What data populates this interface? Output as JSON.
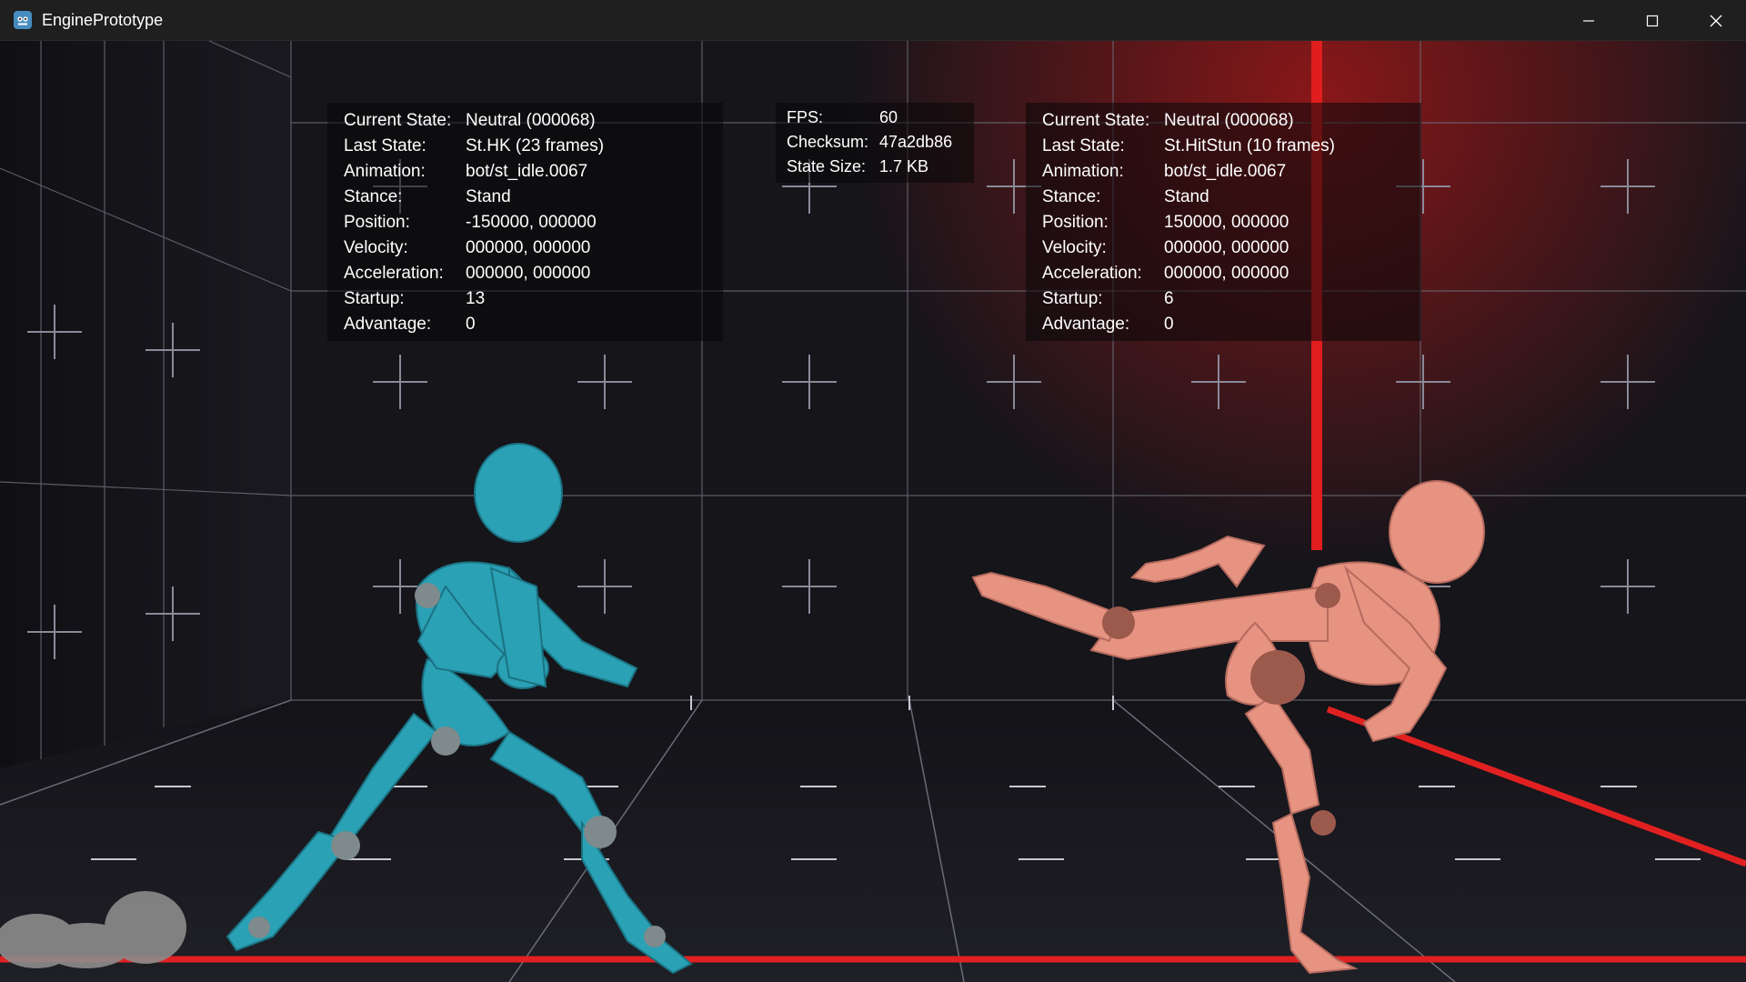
{
  "window": {
    "title": "EnginePrototype",
    "controls": {
      "minimize": "minimize-icon",
      "maximize": "maximize-icon",
      "close": "close-icon"
    }
  },
  "colors": {
    "titlebar": "#1f1f1f",
    "player1": "#2aa1b4",
    "player2": "#e79382",
    "boundary": "#e12121",
    "grid": "#7a7a8a"
  },
  "net_stats": {
    "fps_label": "FPS:",
    "fps_value": "60",
    "checksum_label": "Checksum:",
    "checksum_value": "47a2db86",
    "state_size_label": "State Size:",
    "state_size_value": "1.7 KB"
  },
  "player1": {
    "current_state_label": "Current State:",
    "current_state": "Neutral (000068)",
    "last_state_label": "Last State:",
    "last_state": "St.HK (23 frames)",
    "animation_label": "Animation:",
    "animation": "bot/st_idle.0067",
    "stance_label": "Stance:",
    "stance": "Stand",
    "position_label": "Position:",
    "position": "-150000, 000000",
    "velocity_label": "Velocity:",
    "velocity": "000000, 000000",
    "acceleration_label": "Acceleration:",
    "acceleration": "000000, 000000",
    "startup_label": "Startup:",
    "startup": "13",
    "advantage_label": "Advantage:",
    "advantage": "0"
  },
  "player2": {
    "current_state_label": "Current State:",
    "current_state": "Neutral (000068)",
    "last_state_label": "Last State:",
    "last_state": "St.HitStun (10 frames)",
    "animation_label": "Animation:",
    "animation": "bot/st_idle.0067",
    "stance_label": "Stance:",
    "stance": "Stand",
    "position_label": "Position:",
    "position": "150000, 000000",
    "velocity_label": "Velocity:",
    "velocity": "000000, 000000",
    "acceleration_label": "Acceleration:",
    "acceleration": "000000, 000000",
    "startup_label": "Startup:",
    "startup": "6",
    "advantage_label": "Advantage:",
    "advantage": "0"
  }
}
